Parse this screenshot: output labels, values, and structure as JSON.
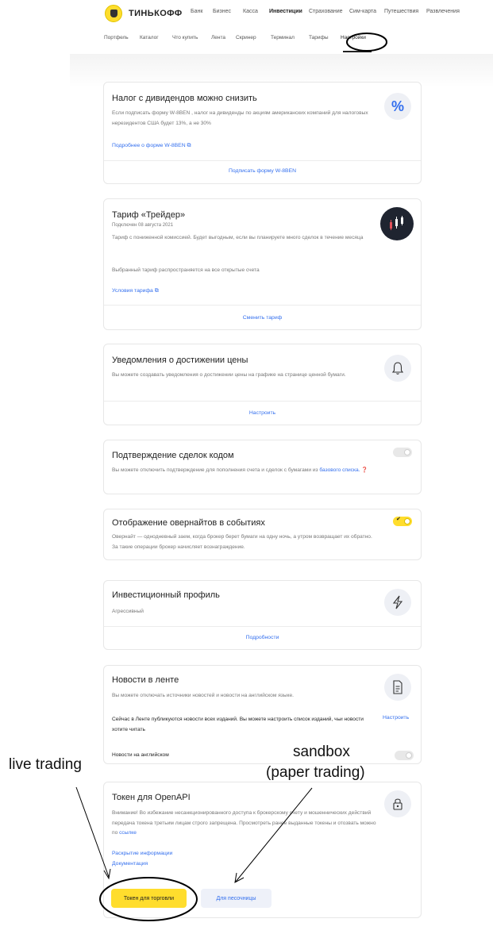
{
  "header": {
    "logo_text": "ТИНЬКОФФ",
    "nav": [
      "Банк",
      "Бизнес",
      "Касса",
      "Инвестиции",
      "Страхование",
      "Сим-карта",
      "Путешествия",
      "Развлечения"
    ],
    "active_nav": "Инвестиции",
    "subnav": [
      "Портфель",
      "Каталог",
      "Что купить",
      "Лента",
      "Скринер",
      "Терминал",
      "Тарифы",
      "Настройки"
    ],
    "active_subnav": "Настройки"
  },
  "cards": {
    "tax": {
      "title": "Налог с дивидендов можно снизить",
      "text": "Если подписать форму W-8BEN , налог на дивиденды по акциям американских компаний для налоговых нерезидентов США будет 13%, а не 30%",
      "link": "Подробнее о форме W-8BEN",
      "action": "Подписать форму W-8BEN",
      "icon": "percent-icon"
    },
    "tariff": {
      "title": "Тариф «Трейдер»",
      "connected": "Подключен 08 августа 2021",
      "text": "Тариф с пониженной комиссией. Будет выгодным, если вы планируете много сделок в течение месяца",
      "text2": "Выбранный тариф распространяется на все открытые счета",
      "link": "Условия тарифа",
      "action": "Сменить тариф",
      "icon": "candlestick-chart-icon"
    },
    "alerts": {
      "title": "Уведомления о достижении цены",
      "text": "Вы можете создавать уведомления о достижении цены на графике на странице ценной бумаги.",
      "action": "Настроить",
      "icon": "bell-icon"
    },
    "confirm": {
      "title": "Подтверждение сделок кодом",
      "text": "Вы можете отключить подтверждение для пополнения счета и сделок с бумагами из",
      "link": "базового списка.",
      "toggle_on": false
    },
    "overnight": {
      "title": "Отображение овернайтов в событиях",
      "text": "Овернайт — однодневный заем, когда брокер берет бумаги на одну ночь, а утром возвращает их обратно. За такие операции брокер начисляет вознаграждение.",
      "toggle_on": true
    },
    "profile": {
      "title": "Инвестиционный профиль",
      "value": "Агрессивный",
      "action": "Подробности",
      "icon": "lightning-icon"
    },
    "news": {
      "title": "Новости в ленте",
      "text": "Вы можете отключать источники новостей и новости на английском языке.",
      "text2": "Сейчас в Ленте публикуются новости всех изданий. Вы можете настроить список изданий, чьи новости хотите читать",
      "action": "Настроить",
      "english_label": "Новости на английском",
      "toggle_on": false,
      "icon": "document-icon"
    },
    "token": {
      "title": "Токен для OpenAPI",
      "text": "Внимание! Во избежание несанкционированного доступа к брокерскому счету и мошеннических действий передача токена третьим лицам строго запрещена. Просмотреть ранее выданные токены и отозвать можно по",
      "text_link": "ссылке",
      "link1": "Раскрытие информации",
      "link2": "Документация",
      "btn_trade": "Токен для торговли",
      "btn_sandbox": "Для песочницы",
      "icon": "lock-icon"
    }
  },
  "annotations": {
    "live": "live trading",
    "sandbox_line1": "sandbox",
    "sandbox_line2": "(paper trading)"
  }
}
